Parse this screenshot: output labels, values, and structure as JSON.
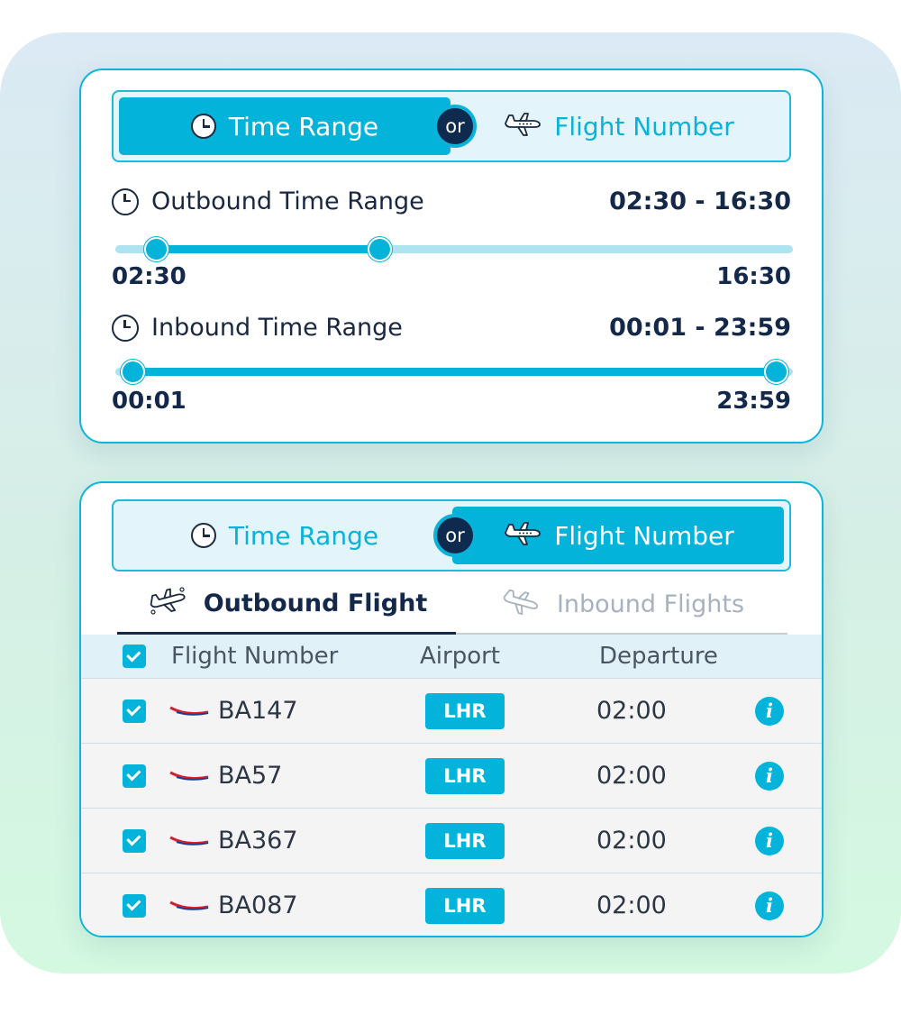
{
  "card1": {
    "toggle": {
      "left_label": "Time Range",
      "right_label": "Flight Number",
      "or_label": "or",
      "active": "left"
    },
    "outbound": {
      "label": "Outbound Time Range",
      "from": "02:30",
      "separator": "-",
      "to": "16:30",
      "min_label": "02:30",
      "max_label": "16:30",
      "lower_fraction": 0.06,
      "upper_fraction": 0.39
    },
    "inbound": {
      "label": "Inbound Time Range",
      "from": "00:01",
      "separator": "-",
      "to": "23:59",
      "min_label": "00:01",
      "max_label": "23:59",
      "lower_fraction": 0.025,
      "upper_fraction": 0.975
    }
  },
  "card2": {
    "toggle": {
      "left_label": "Time Range",
      "right_label": "Flight Number",
      "or_label": "or",
      "active": "right"
    },
    "tabs": [
      {
        "label": "Outbound Flight",
        "active": true,
        "icon": "plane-icon"
      },
      {
        "label": "Inbound Flights",
        "active": false,
        "icon": "plane-icon"
      }
    ],
    "table": {
      "headers": [
        "Flight Number",
        "Airport",
        "Departure"
      ],
      "rows": [
        {
          "flight": "BA147",
          "airport": "LHR",
          "departure": "02:00",
          "checked": true
        },
        {
          "flight": "BA57",
          "airport": "LHR",
          "departure": "02:00",
          "checked": true
        },
        {
          "flight": "BA367",
          "airport": "LHR",
          "departure": "02:00",
          "checked": true
        },
        {
          "flight": "BA087",
          "airport": "LHR",
          "departure": "02:00",
          "checked": true
        }
      ]
    }
  },
  "colors": {
    "accent": "#03b3da",
    "navy": "#0e2a4e",
    "toggle_bg": "#e3f5fa",
    "track_bg": "#aee4f0"
  }
}
